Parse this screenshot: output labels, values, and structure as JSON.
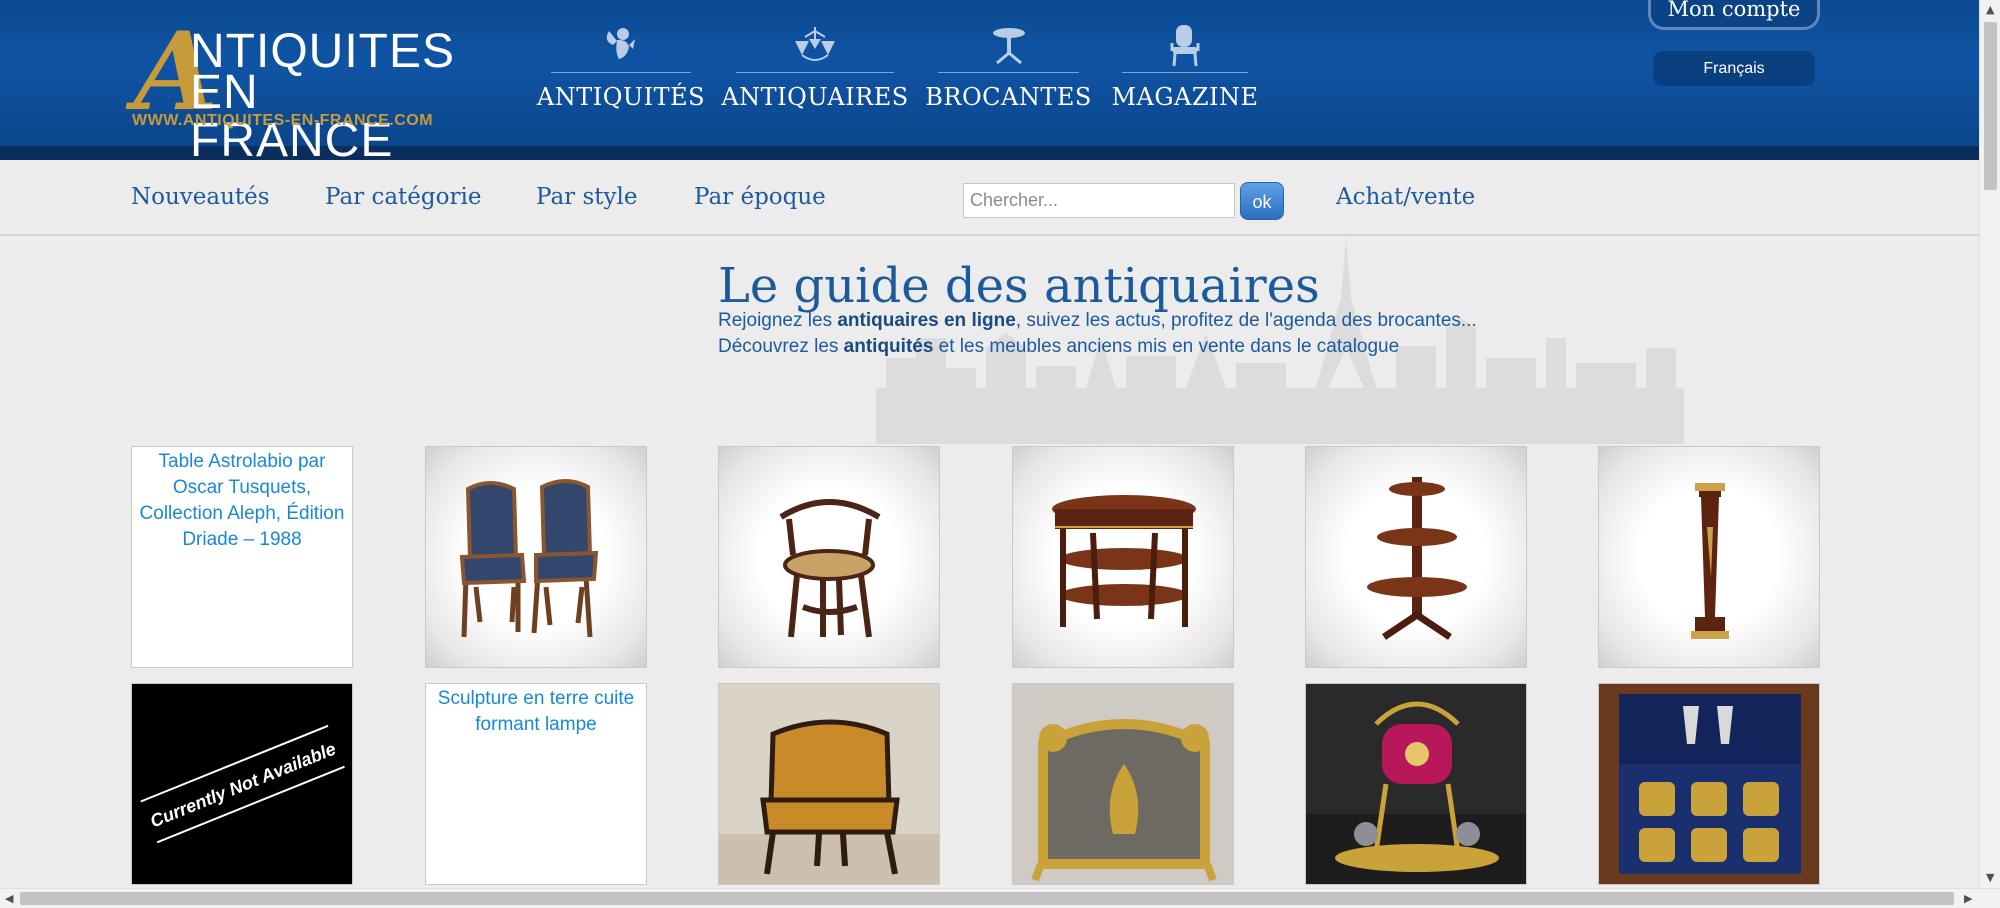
{
  "header": {
    "logo_line1": "NTIQUITES",
    "logo_line2": "EN FRANCE",
    "logo_initial": "A",
    "logo_url": "WWW.ANTIQUITES-EN-FRANCE.COM",
    "nav": [
      {
        "label": "ANTIQUITÉS",
        "icon": "cherub-icon"
      },
      {
        "label": "ANTIQUAIRES",
        "icon": "chandelier-icon"
      },
      {
        "label": "BROCANTES",
        "icon": "pedestal-table-icon"
      },
      {
        "label": "MAGAZINE",
        "icon": "armchair-icon"
      }
    ],
    "account_label": "Mon compte",
    "language_label": "Français"
  },
  "subnav": {
    "items": [
      "Nouveautés",
      "Par catégorie",
      "Par style",
      "Par époque"
    ],
    "search_placeholder": "Chercher...",
    "search_button": "ok",
    "achat_vente": "Achat/vente"
  },
  "intro": {
    "title": "Le guide des antiquaires",
    "line1_pre": "Rejoignez les ",
    "line1_bold": "antiquaires en ligne",
    "line1_post": ", suivez les actus, profitez de l'agenda des brocantes...",
    "line2_pre": "Découvrez les ",
    "line2_bold": "antiquités",
    "line2_post": " et les meubles anciens mis en vente dans le catalogue"
  },
  "products": {
    "broken_alt_1": "Table Astrolabio par Oscar Tusquets, Collection Aleph, Édition Driade – 1988",
    "broken_alt_2": "Sculpture en terre cuite formant lampe",
    "not_available": "Currently Not Available"
  },
  "colors": {
    "header_blue": "#0f54a4",
    "link_blue": "#1d5a9c",
    "gold": "#c79a3a"
  }
}
